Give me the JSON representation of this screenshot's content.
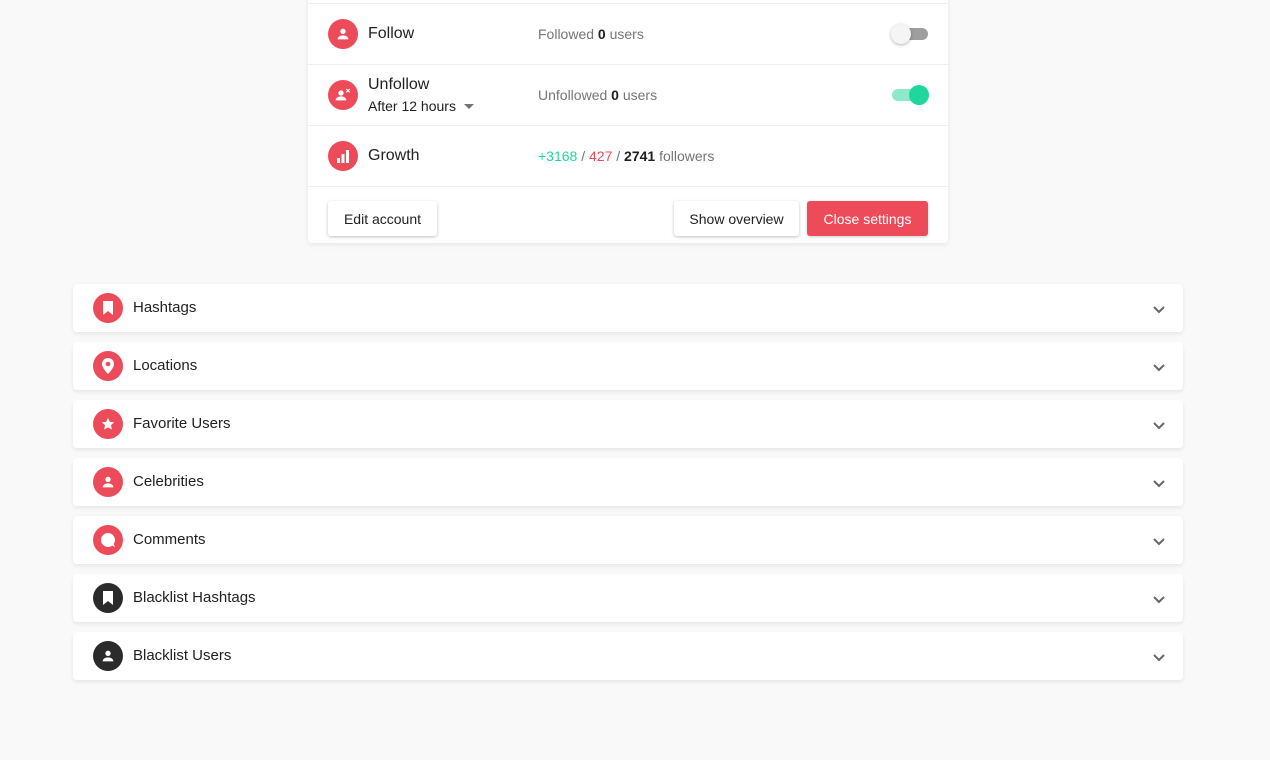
{
  "settings": {
    "follow": {
      "title": "Follow",
      "stat_prefix": "Followed ",
      "count": "0",
      "stat_suffix": " users",
      "enabled": false
    },
    "unfollow": {
      "title": "Unfollow",
      "delay": "After 12 hours",
      "stat_prefix": "Unfollowed ",
      "count": "0",
      "stat_suffix": " users",
      "enabled": true
    },
    "growth": {
      "title": "Growth",
      "gained": "+3168",
      "sep1": " / ",
      "lost": "427",
      "sep2": " / ",
      "total": "2741",
      "suffix": " followers"
    },
    "actions": {
      "edit": "Edit account",
      "overview": "Show overview",
      "close": "Close settings"
    }
  },
  "sections": [
    {
      "label": "Hashtags",
      "icon": "bookmark-icon",
      "color": "#ee4b5a"
    },
    {
      "label": "Locations",
      "icon": "location-pin-icon",
      "color": "#ee4b5a"
    },
    {
      "label": "Favorite Users",
      "icon": "star-icon",
      "color": "#ee4b5a"
    },
    {
      "label": "Celebrities",
      "icon": "person-icon",
      "color": "#ee4b5a"
    },
    {
      "label": "Comments",
      "icon": "comment-bubble-icon",
      "color": "#ee4b5a"
    },
    {
      "label": "Blacklist Hashtags",
      "icon": "bookmark-icon",
      "color": "#2b2b2b"
    },
    {
      "label": "Blacklist Users",
      "icon": "person-icon",
      "color": "#2b2b2b"
    }
  ],
  "colors": {
    "accent": "#ee4b5a",
    "success": "#1fd79d",
    "dark_icon": "#2b2b2b"
  }
}
